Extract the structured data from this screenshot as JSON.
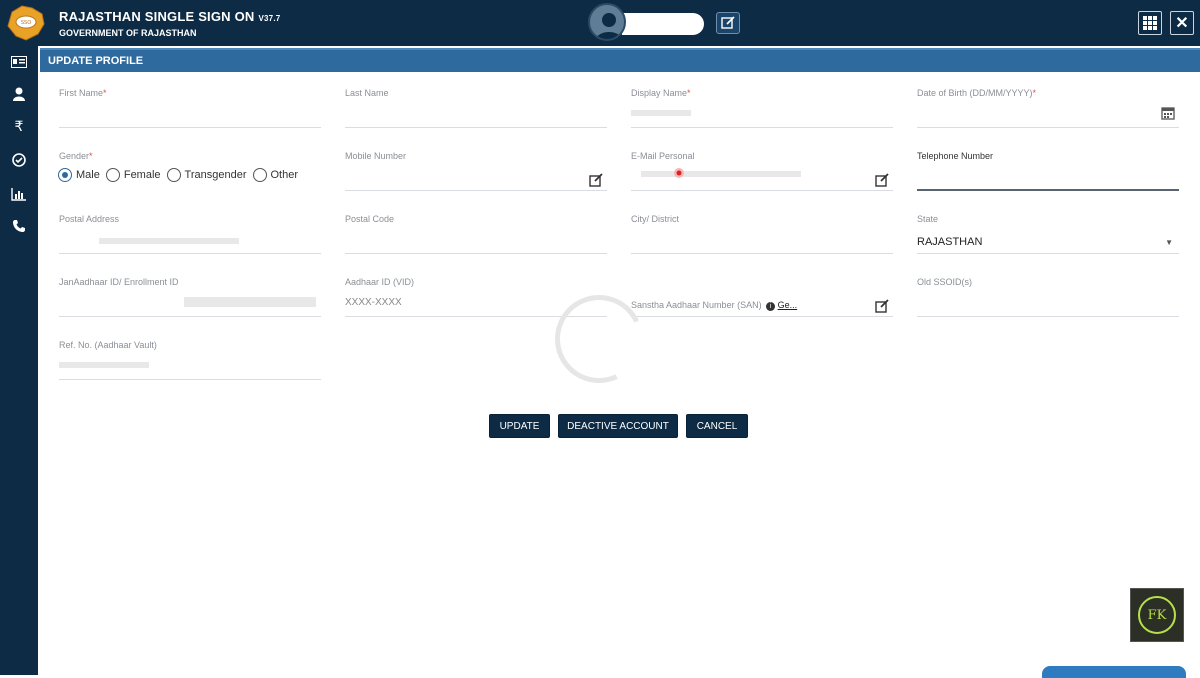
{
  "header": {
    "title": "RAJASTHAN SINGLE SIGN ON",
    "version": "V37.7",
    "subtitle": "GOVERNMENT OF RAJASTHAN"
  },
  "sidebar": {
    "items": [
      {
        "icon": "id-card-icon"
      },
      {
        "icon": "user-icon"
      },
      {
        "icon": "rupee-icon"
      },
      {
        "icon": "check-circle-icon"
      },
      {
        "icon": "bar-chart-icon"
      },
      {
        "icon": "phone-icon"
      }
    ]
  },
  "section": {
    "title": "UPDATE PROFILE"
  },
  "form": {
    "first_name_label": "First Name",
    "last_name_label": "Last Name",
    "display_name_label": "Display Name",
    "dob_label": "Date of Birth (DD/MM/YYYY)",
    "gender_label": "Gender",
    "gender_options": [
      "Male",
      "Female",
      "Transgender",
      "Other"
    ],
    "gender_selected": "Male",
    "mobile_label": "Mobile Number",
    "email_label": "E-Mail Personal",
    "telephone_label": "Telephone Number",
    "postal_address_label": "Postal Address",
    "postal_code_label": "Postal Code",
    "city_label": "City/ District",
    "state_label": "State",
    "state_value": "RAJASTHAN",
    "janaadhaar_label": "JanAadhaar ID/ Enrollment ID",
    "aadhaar_label": "Aadhaar ID (VID)",
    "aadhaar_value": "XXXX-XXXX",
    "san_label": "Sanstha Aadhaar Number (SAN)",
    "san_link": "Ge...",
    "old_ssoid_label": "Old SSOID(s)",
    "ref_no_label": "Ref. No. (Aadhaar Vault)",
    "required_mark": "*"
  },
  "actions": {
    "update": "UPDATE",
    "deactive": "DEACTIVE ACCOUNT",
    "cancel": "CANCEL"
  },
  "watermark": {
    "text": "FK"
  },
  "colors": {
    "navy": "#0d2b45",
    "header_blue": "#2e6a9e",
    "required_red": "#d9534f",
    "watermark_green": "#b8e04a"
  }
}
